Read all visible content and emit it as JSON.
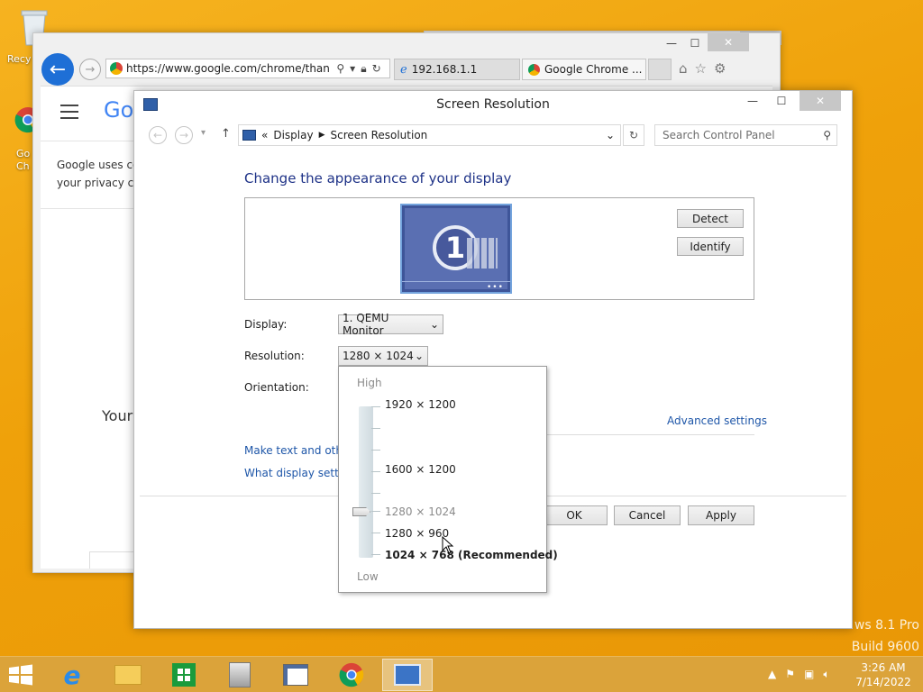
{
  "desktop": {
    "recycle_label": "Recy",
    "chrome_label_1": "Go",
    "chrome_label_2": "Ch",
    "watermark_line1": "ws 8.1 Pro",
    "watermark_line2": "Build 9600"
  },
  "ie": {
    "address": "https://www.google.com/chrome/thank-",
    "tabs": [
      {
        "label": "192.168.1.1"
      },
      {
        "label": "Google Chrome ..."
      }
    ],
    "page_logo": "Go",
    "page_text_1": "Google uses coo",
    "page_text_2": "your privacy cor",
    "page_text_3": "Your"
  },
  "sr": {
    "title": "Screen Resolution",
    "breadcrumb": {
      "root_sep": "«",
      "item1": "Display",
      "item2": "Screen Resolution"
    },
    "search_placeholder": "Search Control Panel",
    "heading": "Change the appearance of your display",
    "monitor_number": "1",
    "detect_label": "Detect",
    "identify_label": "Identify",
    "display_label": "Display:",
    "display_value": "1. QEMU Monitor",
    "resolution_label": "Resolution:",
    "resolution_value": "1280 × 1024",
    "orientation_label": "Orientation:",
    "advanced_link": "Advanced settings",
    "link1": "Make text and other",
    "link2": "What display setting",
    "ok_label": "OK",
    "cancel_label": "Cancel",
    "apply_label": "Apply"
  },
  "dropdown": {
    "high_label": "High",
    "low_label": "Low",
    "options": [
      "1920 × 1200",
      "1600 × 1200",
      "1280 × 1024",
      "1280 × 960",
      "1024 × 768 (Recommended)"
    ]
  },
  "taskbar": {
    "time": "3:26 AM",
    "date": "7/14/2022"
  },
  "colors": {
    "desktop": "#efa10a",
    "accent_link": "#1e56a8",
    "heading": "#1e3287"
  }
}
